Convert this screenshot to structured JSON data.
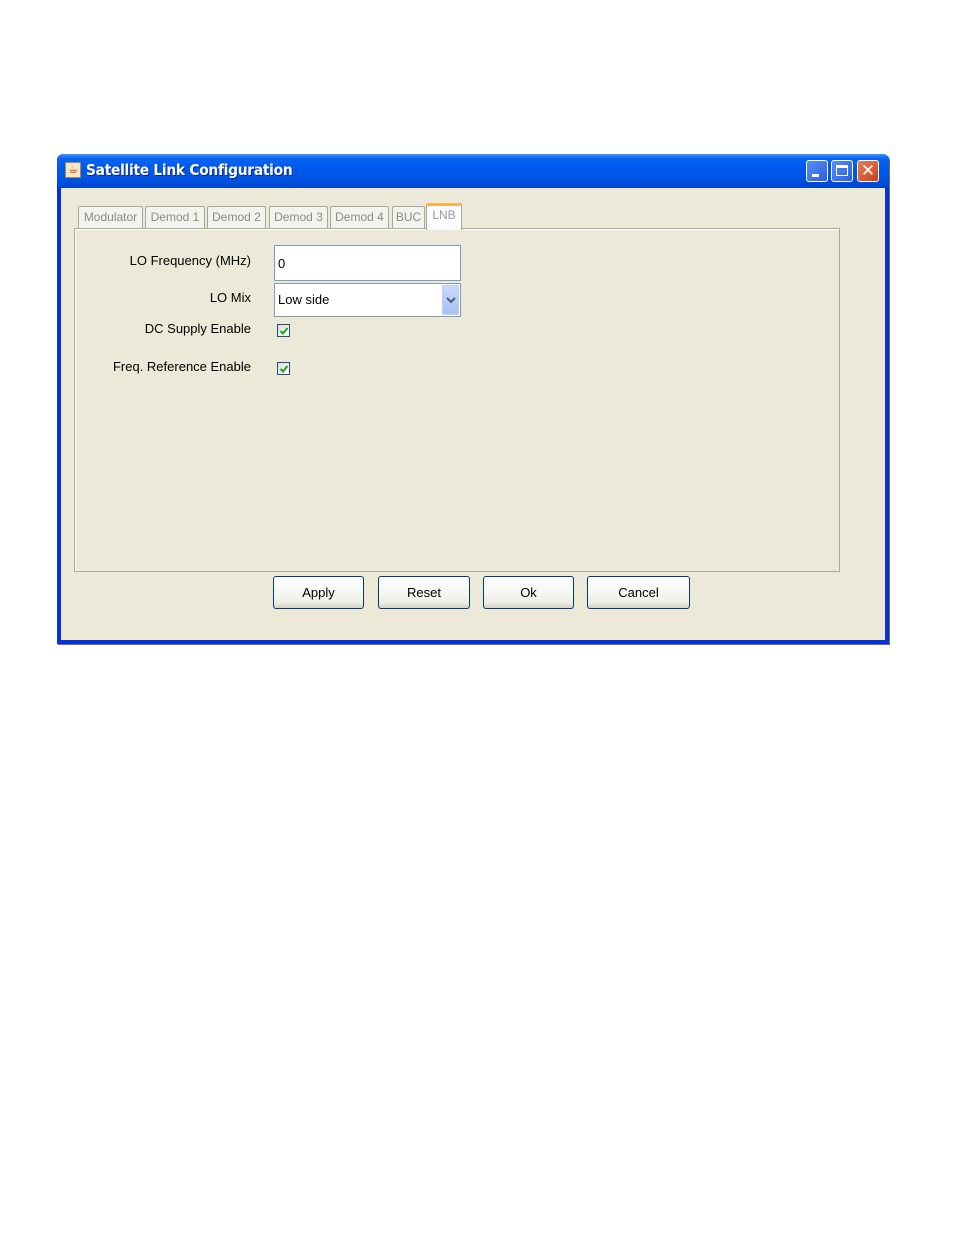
{
  "window": {
    "title": "Satellite Link Configuration",
    "icon": "java-coffee-icon",
    "controls": {
      "minimize": "minimize-icon",
      "maximize": "maximize-icon",
      "close": "close-icon",
      "close_glyph": "✕"
    }
  },
  "tabs": [
    {
      "label": "Modulator",
      "active": false
    },
    {
      "label": "Demod 1",
      "active": false
    },
    {
      "label": "Demod 2",
      "active": false
    },
    {
      "label": "Demod 3",
      "active": false
    },
    {
      "label": "Demod 4",
      "active": false
    },
    {
      "label": "BUC",
      "active": false
    },
    {
      "label": "LNB",
      "active": true
    }
  ],
  "form": {
    "lo_frequency": {
      "label": "LO Frequency (MHz)",
      "value": "0"
    },
    "lo_mix": {
      "label": "LO Mix",
      "value": "Low side"
    },
    "dc_supply_enable": {
      "label": "DC Supply Enable",
      "checked": true
    },
    "freq_reference_enable": {
      "label": "Freq. Reference Enable",
      "checked": true
    }
  },
  "buttons": {
    "apply": "Apply",
    "reset": "Reset",
    "ok": "Ok",
    "cancel": "Cancel"
  }
}
